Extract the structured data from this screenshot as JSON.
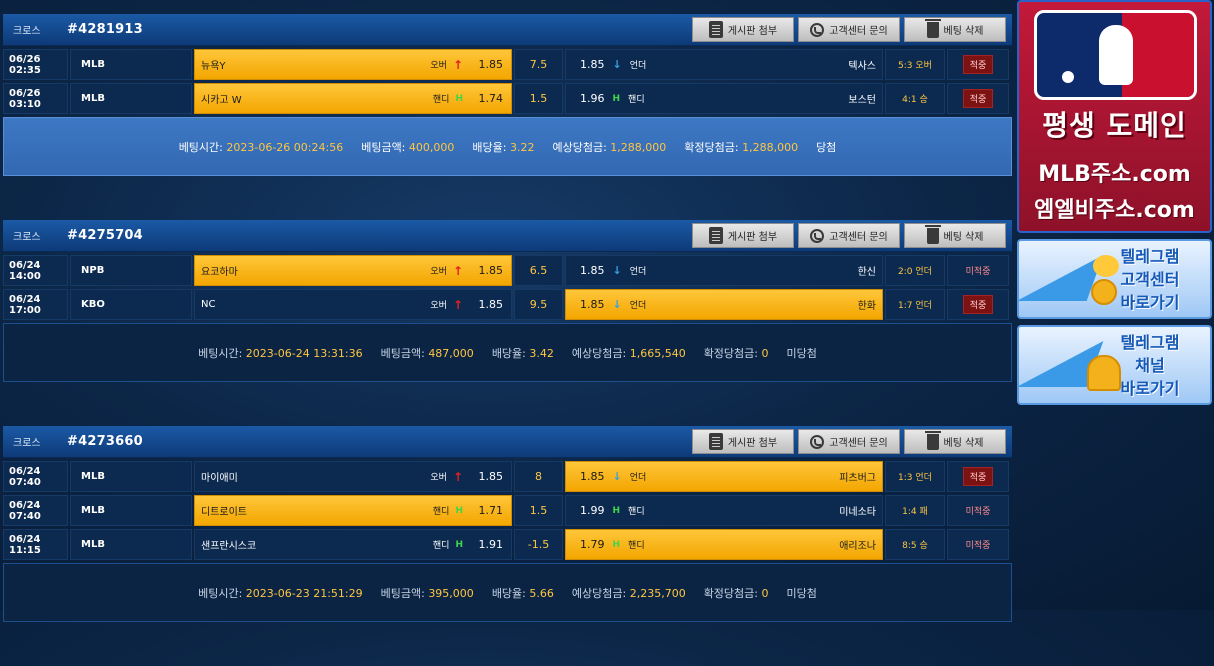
{
  "header_buttons": {
    "board": "게시판 첨부",
    "support": "고객센터 문의",
    "delete": "베팅 삭제"
  },
  "summary_labels": {
    "bet_time": "베팅시간:",
    "bet_amount": "베팅금액:",
    "odds": "배당율:",
    "expected": "예상당첨금:",
    "confirmed": "확정당첨금:"
  },
  "bets": [
    {
      "type": "크로스",
      "id": "#4281913",
      "rows": [
        {
          "date": "06/26 02:35",
          "league": "MLB",
          "home": "뉴욕Y",
          "home_tag": "오버",
          "home_odd": "1.85",
          "line": "7.5",
          "away_odd": "1.85",
          "away_tag": "언더",
          "away": "텍사스",
          "score": "5:3 오버",
          "status": "적중"
        },
        {
          "date": "06/26 03:10",
          "league": "MLB",
          "home": "시카고 W",
          "home_tag": "핸디",
          "home_odd": "1.74",
          "line": "1.5",
          "away_odd": "1.96",
          "away_tag": "핸디",
          "away": "보스턴",
          "score": "4:1 승",
          "status": "적중"
        }
      ],
      "summary": {
        "bet_time": "2023-06-26 00:24:56",
        "bet_amount": "400,000",
        "odds": "3.22",
        "expected": "1,288,000",
        "confirmed": "1,288,000",
        "result": "당첨"
      }
    },
    {
      "type": "크로스",
      "id": "#4275704",
      "rows": [
        {
          "date": "06/24 14:00",
          "league": "NPB",
          "home": "요코하마",
          "home_tag": "오버",
          "home_odd": "1.85",
          "line": "6.5",
          "away_odd": "1.85",
          "away_tag": "언더",
          "away": "한신",
          "score": "2:0 언더",
          "status": "미적중"
        },
        {
          "date": "06/24 17:00",
          "league": "KBO",
          "home": "NC",
          "home_tag": "오버",
          "home_odd": "1.85",
          "line": "9.5",
          "away_odd": "1.85",
          "away_tag": "언더",
          "away": "한화",
          "score": "1:7 언더",
          "status": "적중"
        }
      ],
      "summary": {
        "bet_time": "2023-06-24 13:31:36",
        "bet_amount": "487,000",
        "odds": "3.42",
        "expected": "1,665,540",
        "confirmed": "0",
        "result": "미당첨"
      }
    },
    {
      "type": "크로스",
      "id": "#4273660",
      "rows": [
        {
          "date": "06/24 07:40",
          "league": "MLB",
          "home": "마이애미",
          "home_tag": "오버",
          "home_odd": "1.85",
          "line": "8",
          "away_odd": "1.85",
          "away_tag": "언더",
          "away": "피츠버그",
          "score": "1:3 언더",
          "status": "적중"
        },
        {
          "date": "06/24 07:40",
          "league": "MLB",
          "home": "디트로이트",
          "home_tag": "핸디",
          "home_odd": "1.71",
          "line": "1.5",
          "away_odd": "1.99",
          "away_tag": "핸디",
          "away": "미네소타",
          "score": "1:4 패",
          "status": "미적중"
        },
        {
          "date": "06/24 11:15",
          "league": "MLB",
          "home": "샌프란시스코",
          "home_tag": "핸디",
          "home_odd": "1.91",
          "line": "-1.5",
          "away_odd": "1.79",
          "away_tag": "핸디",
          "away": "애리조나",
          "score": "8:5 승",
          "status": "미적중"
        }
      ],
      "summary": {
        "bet_time": "2023-06-23 21:51:29",
        "bet_amount": "395,000",
        "odds": "5.66",
        "expected": "2,235,700",
        "confirmed": "0",
        "result": "미당첨"
      }
    }
  ],
  "sidebar": {
    "mlb_ad": {
      "line1": "평생 도메인",
      "line2": "MLB주소.com",
      "line3": "엠엘비주소.com"
    },
    "tg_support": {
      "line1": "텔레그램",
      "line2": "고객센터",
      "line3": "바로가기"
    },
    "tg_channel": {
      "line1": "텔레그램",
      "line2": "채널",
      "line3": "바로가기"
    }
  }
}
